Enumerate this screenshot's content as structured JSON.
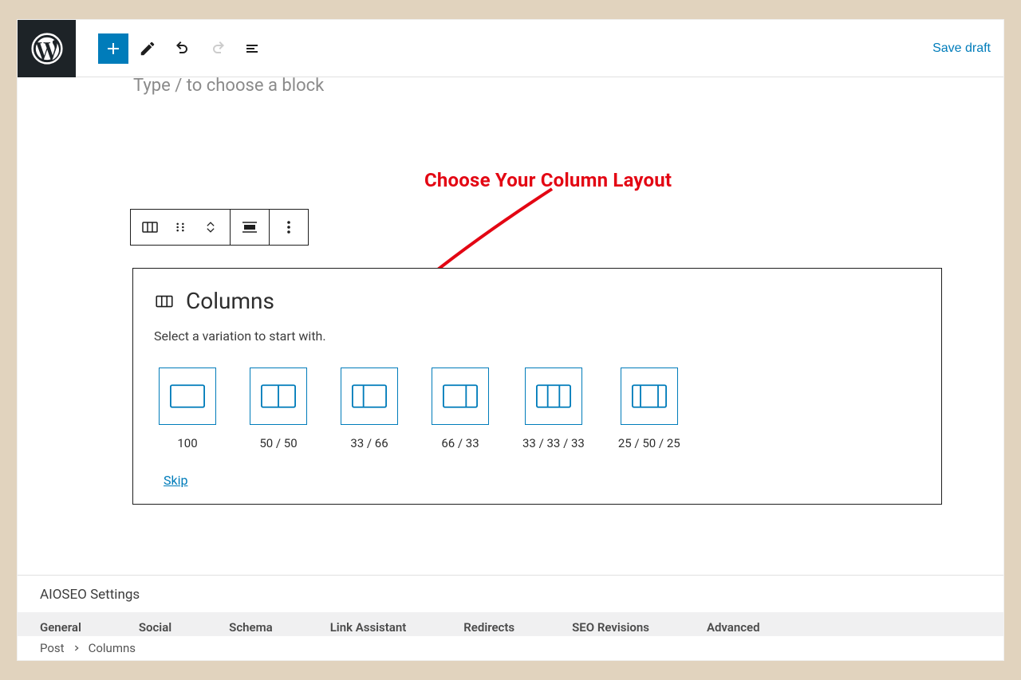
{
  "toolbar": {
    "save_draft": "Save draft",
    "placeholder_hint": "Type / to choose a block"
  },
  "annotation": "Choose Your Column Layout",
  "columns_block": {
    "title": "Columns",
    "description": "Select a variation to start with.",
    "variations": [
      {
        "label": "100"
      },
      {
        "label": "50 / 50"
      },
      {
        "label": "33 / 66"
      },
      {
        "label": "66 / 33"
      },
      {
        "label": "33 / 33 / 33"
      },
      {
        "label": "25 / 50 / 25"
      }
    ],
    "skip": "Skip"
  },
  "aioseo": {
    "title": "AIOSEO Settings",
    "tabs": [
      "General",
      "Social",
      "Schema",
      "Link Assistant",
      "Redirects",
      "SEO Revisions",
      "Advanced"
    ]
  },
  "breadcrumb": {
    "root": "Post",
    "current": "Columns"
  }
}
